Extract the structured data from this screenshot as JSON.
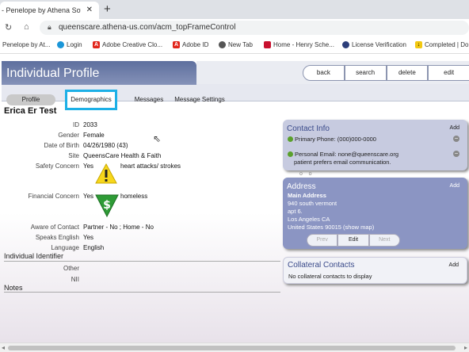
{
  "browser": {
    "tab_title": "- Penelope by Athena Softwa",
    "tab_close": "✕",
    "new_tab": "+",
    "url": "queenscare.athena-us.com/acm_topFrameControl",
    "bookmarks": [
      {
        "label": "Penelope by At...",
        "icon": "penelope-icon",
        "color": "#e8e8e8"
      },
      {
        "label": "Login",
        "icon": "salesforce-icon",
        "color": "#1b96d8"
      },
      {
        "label": "Adobe Creative Clo...",
        "icon": "adobe-icon",
        "color": "#e1251b"
      },
      {
        "label": "Adobe ID",
        "icon": "adobe-icon",
        "color": "#e1251b"
      },
      {
        "label": "New Tab",
        "icon": "globe-icon",
        "color": "#555555"
      },
      {
        "label": "Home - Henry Sche...",
        "icon": "henry-schein-icon",
        "color": "#c8102e"
      },
      {
        "label": "License Verification",
        "icon": "seal-icon",
        "color": "#2c3e7a"
      },
      {
        "label": "Completed | Do",
        "icon": "download-icon",
        "color": "#f2c811"
      }
    ]
  },
  "header": {
    "title": "Individual Profile",
    "actions": [
      "back",
      "search",
      "delete",
      "edit"
    ]
  },
  "tabs": {
    "profile": "Profile",
    "demographics": "Demographics",
    "messages": "Messages",
    "message_settings": "Message Settings"
  },
  "person": {
    "name": "Erica Er Test",
    "fields": {
      "id_label": "ID",
      "id": "2033",
      "gender_label": "Gender",
      "gender": "Female",
      "dob_label": "Date of Birth",
      "dob": "04/26/1980 (43)",
      "site_label": "Site",
      "site": "QueensCare Health & Faith",
      "safety_label": "Safety Concern",
      "safety": "Yes",
      "safety_note": "heart attacks/ strokes",
      "financial_label": "Financial Concern",
      "financial": "Yes",
      "financial_note": "homeless",
      "aware_label": "Aware of Contact",
      "aware": "Partner - No ;  Home - No",
      "english_label": "Speaks English",
      "english": "Yes",
      "language_label": "Language",
      "language": "English"
    },
    "identifier_title": "Individual Identifier",
    "other_label": "Other",
    "nii_label": "NII",
    "notes_title": "Notes"
  },
  "contact_info": {
    "title": "Contact Info",
    "add": "Add",
    "phone": "Primary Phone: (000)000-0000",
    "email": "Personal Email: none@queenscare.org",
    "email_note": "patient prefers email communication."
  },
  "address": {
    "title": "Address",
    "add": "Add",
    "label": "Main Address",
    "line1": "940 south vermont",
    "line2": "apt 6.",
    "city": "Los Angeles CA",
    "country": "United States 90015 (show map)",
    "buttons": [
      "Prev",
      "Edit",
      "Next"
    ]
  },
  "collateral": {
    "title": "Collateral Contacts",
    "add": "Add",
    "empty": "No collateral contacts to display"
  },
  "colors": {
    "header_blue": "#5e6f9e",
    "highlight": "#1db0e6",
    "card_blue": "#c7cbe0",
    "address_blue": "#8b95c3"
  }
}
